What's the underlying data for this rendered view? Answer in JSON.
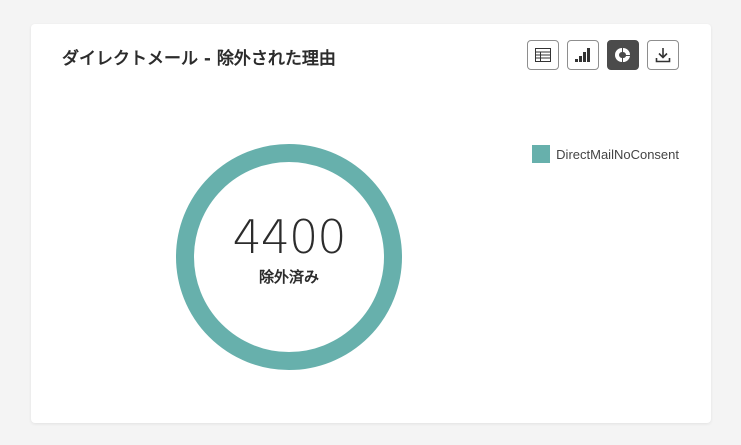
{
  "card": {
    "title": "ダイレクトメール - 除外された理由"
  },
  "toolbar": {
    "buttons": [
      {
        "icon": "table-icon",
        "active": false
      },
      {
        "icon": "bar-chart-icon",
        "active": false
      },
      {
        "icon": "donut-chart-icon",
        "active": true
      },
      {
        "icon": "download-icon",
        "active": false
      }
    ]
  },
  "colors": {
    "series": "#67b0ac",
    "text": "#2c2c2c",
    "active_button": "#4b4b4b"
  },
  "chart_data": {
    "type": "pie",
    "variant": "donut",
    "slices": [
      {
        "label": "DirectMailNoConsent",
        "value": 4400,
        "color": "#67b0ac"
      }
    ],
    "total": "4400",
    "center_label": "除外済み",
    "legend_placement": "top-right"
  }
}
